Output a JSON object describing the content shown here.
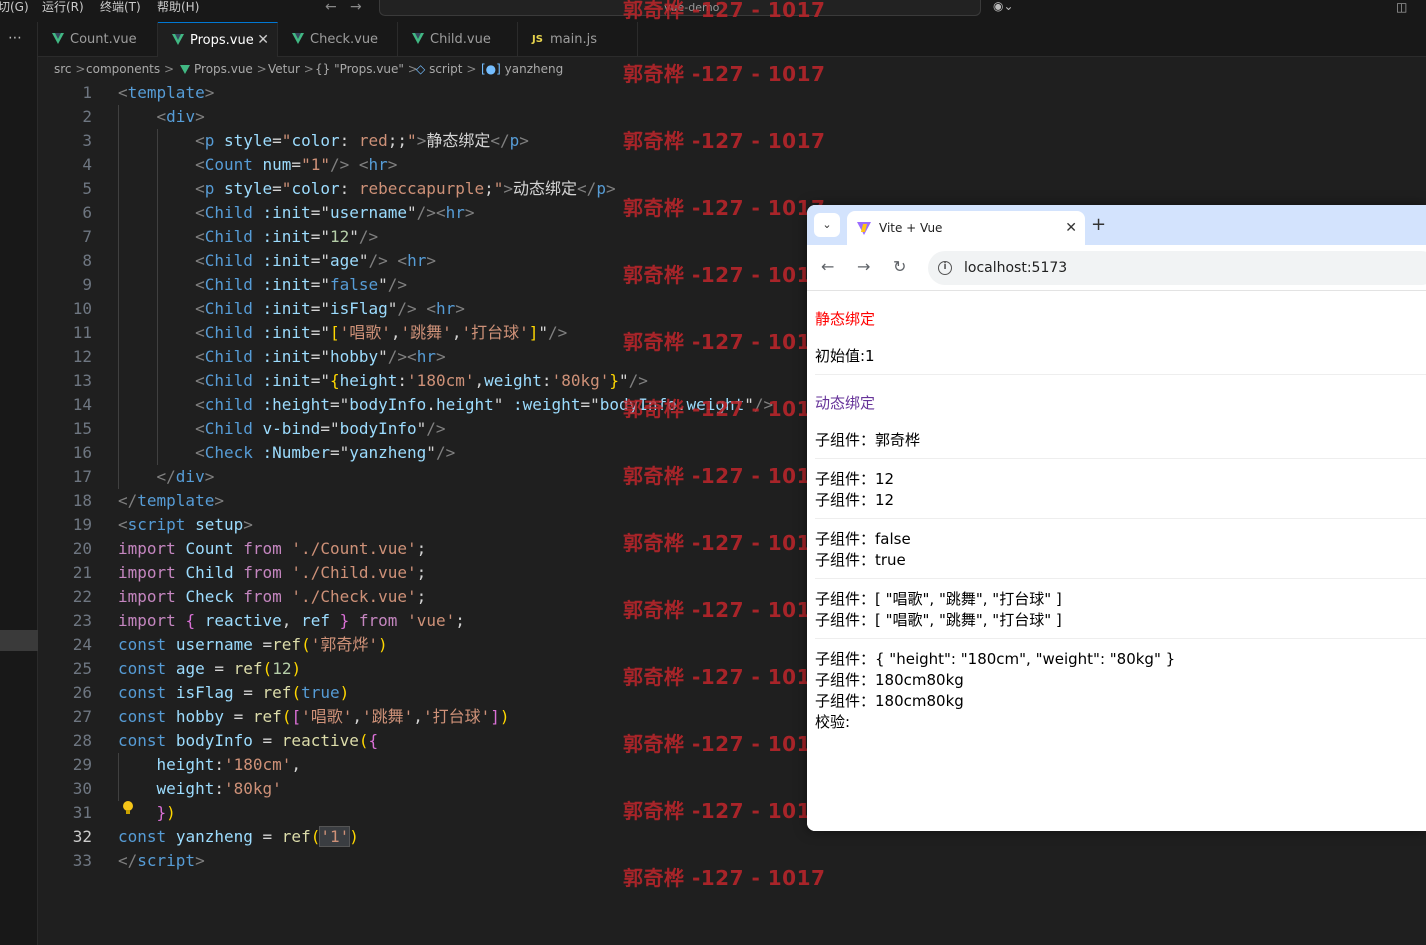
{
  "menu": [
    "切(G)",
    "运行(R)",
    "终端(T)",
    "帮助(H)"
  ],
  "window_title": "vue-demo",
  "tabs": [
    {
      "label": "Count.vue",
      "icon": "vue-icon"
    },
    {
      "label": "Props.vue",
      "icon": "vue-icon",
      "active": true
    },
    {
      "label": "Check.vue",
      "icon": "vue-icon"
    },
    {
      "label": "Child.vue",
      "icon": "vue-icon"
    },
    {
      "label": "main.js",
      "icon": "js-icon"
    }
  ],
  "breadcrumb": [
    "src",
    "components",
    "Props.vue",
    "Vetur",
    "{} \"Props.vue\"",
    "script",
    "yanzheng"
  ],
  "code_lines": [
    "1",
    "2",
    "3",
    "4",
    "5",
    "6",
    "7",
    "8",
    "9",
    "10",
    "11",
    "12",
    "13",
    "14",
    "15",
    "16",
    "17",
    "18",
    "19",
    "20",
    "21",
    "22",
    "23",
    "24",
    "25",
    "26",
    "27",
    "28",
    "29",
    "30",
    "31",
    "32",
    "33"
  ],
  "watermark": "郭奇桦 -127 - 1017",
  "browser": {
    "tab_title": "Vite + Vue",
    "url": "localhost:5173",
    "content": {
      "static_title": "静态绑定",
      "init_value": "初始值:1",
      "dynamic_title": "动态绑定",
      "child_1": "子组件：郭奇桦",
      "child_2": "子组件：12",
      "child_3": "子组件：12",
      "child_4": "子组件：false",
      "child_5": "子组件：true",
      "child_6": "子组件：[ \"唱歌\", \"跳舞\", \"打台球\" ]",
      "child_7": "子组件：[ \"唱歌\", \"跳舞\", \"打台球\" ]",
      "child_8": "子组件：{ \"height\": \"180cm\", \"weight\": \"80kg\" }",
      "child_9": "子组件：180cm80kg",
      "child_10": "子组件：180cm80kg",
      "check": "校验:"
    }
  },
  "colors": {
    "static_title": "#ff0000",
    "dynamic_title": "#663399",
    "watermark": "#c0262b"
  }
}
